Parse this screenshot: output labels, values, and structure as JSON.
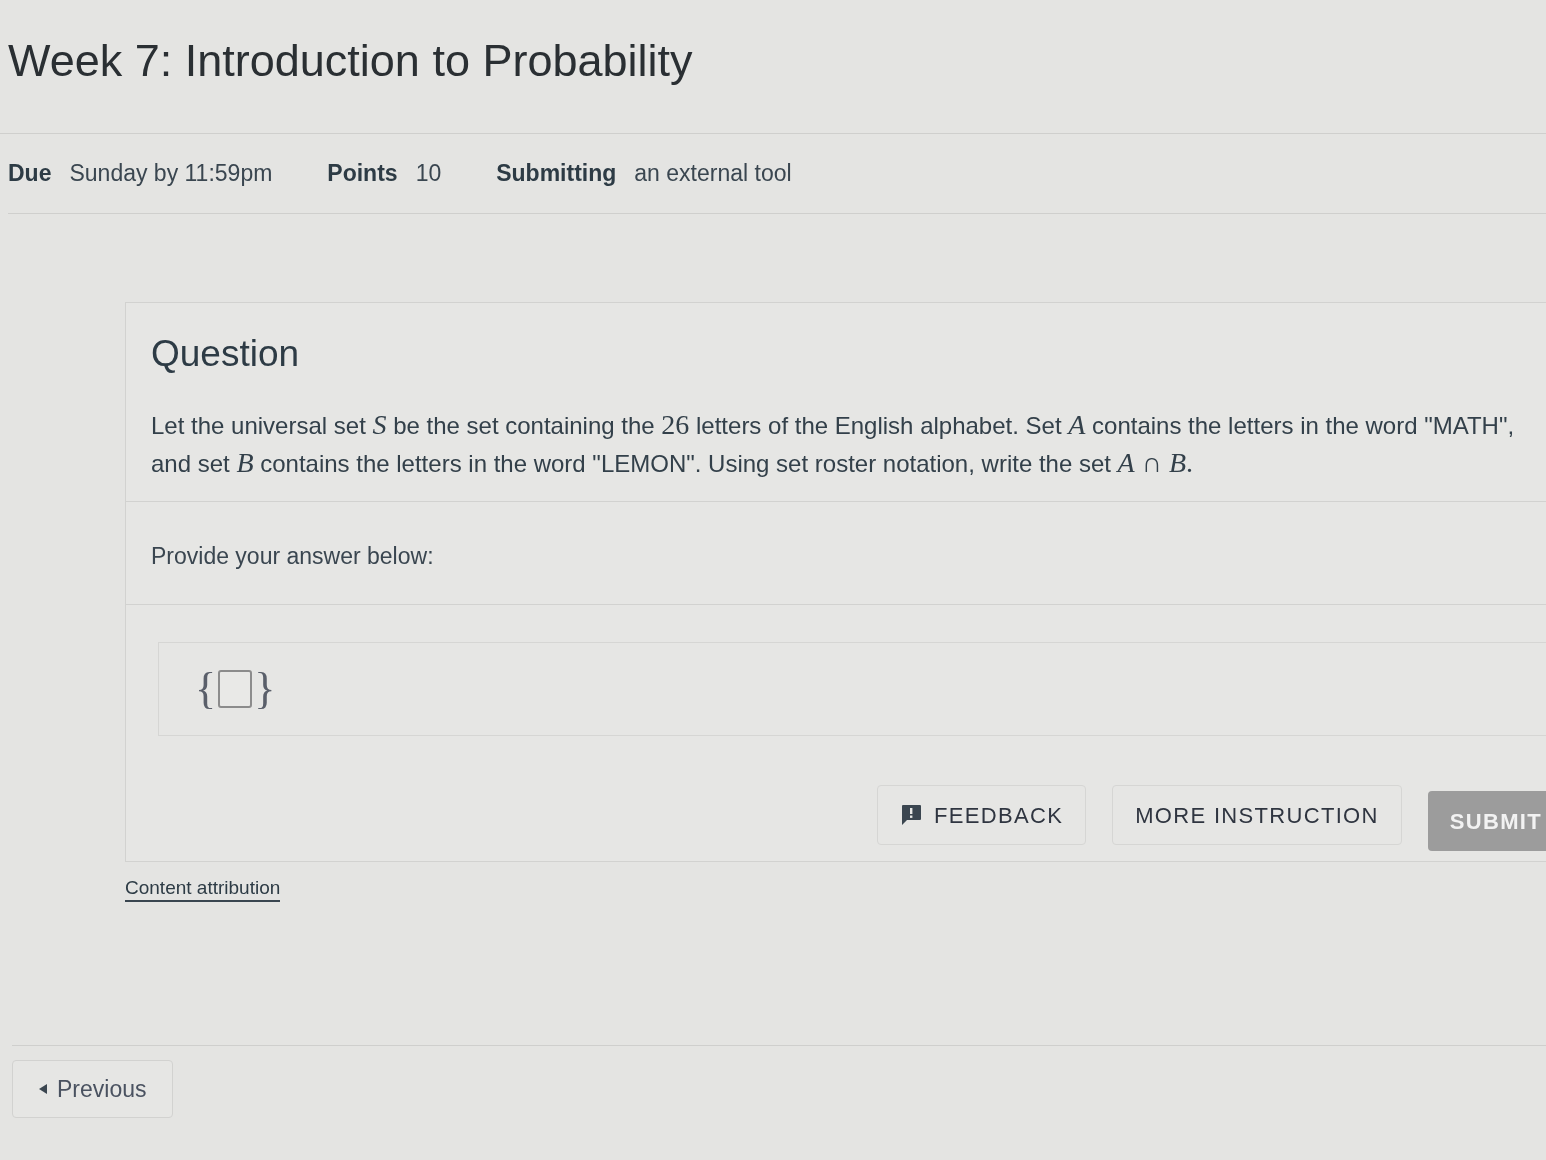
{
  "page": {
    "title": "Week 7: Introduction to Probability"
  },
  "details": [
    {
      "label": "Due",
      "value": "Sunday by 11:59pm"
    },
    {
      "label": "Points",
      "value": "10"
    },
    {
      "label": "Submitting",
      "value": "an external tool"
    }
  ],
  "question": {
    "heading": "Question",
    "segments": [
      {
        "kind": "text",
        "text": "Let the universal set "
      },
      {
        "kind": "var",
        "text": "S"
      },
      {
        "kind": "text",
        "text": " be the set containing the "
      },
      {
        "kind": "num",
        "text": "26"
      },
      {
        "kind": "text",
        "text": " letters of the English alphabet. Set "
      },
      {
        "kind": "var",
        "text": "A"
      },
      {
        "kind": "text",
        "text": " contains the letters in the word \"MATH\", and set "
      },
      {
        "kind": "var",
        "text": "B"
      },
      {
        "kind": "text",
        "text": " contains the letters in the word \"LEMON\". Using set roster notation, write the set "
      },
      {
        "kind": "var",
        "text": "A"
      },
      {
        "kind": "num",
        "text": " ∩ "
      },
      {
        "kind": "var",
        "text": "B"
      },
      {
        "kind": "num",
        "text": "."
      }
    ],
    "prompt": "Provide your answer below:",
    "answer": {
      "open": "{",
      "close": "}"
    },
    "buttons": [
      {
        "label": "FEEDBACK",
        "kind": "icon",
        "disabled": false
      },
      {
        "label": "MORE INSTRUCTION",
        "kind": "plain",
        "disabled": false
      },
      {
        "label": "SUBMIT",
        "kind": "primary",
        "disabled": true
      }
    ]
  },
  "content_attribution": "Content attribution",
  "previous_button": "Previous"
}
